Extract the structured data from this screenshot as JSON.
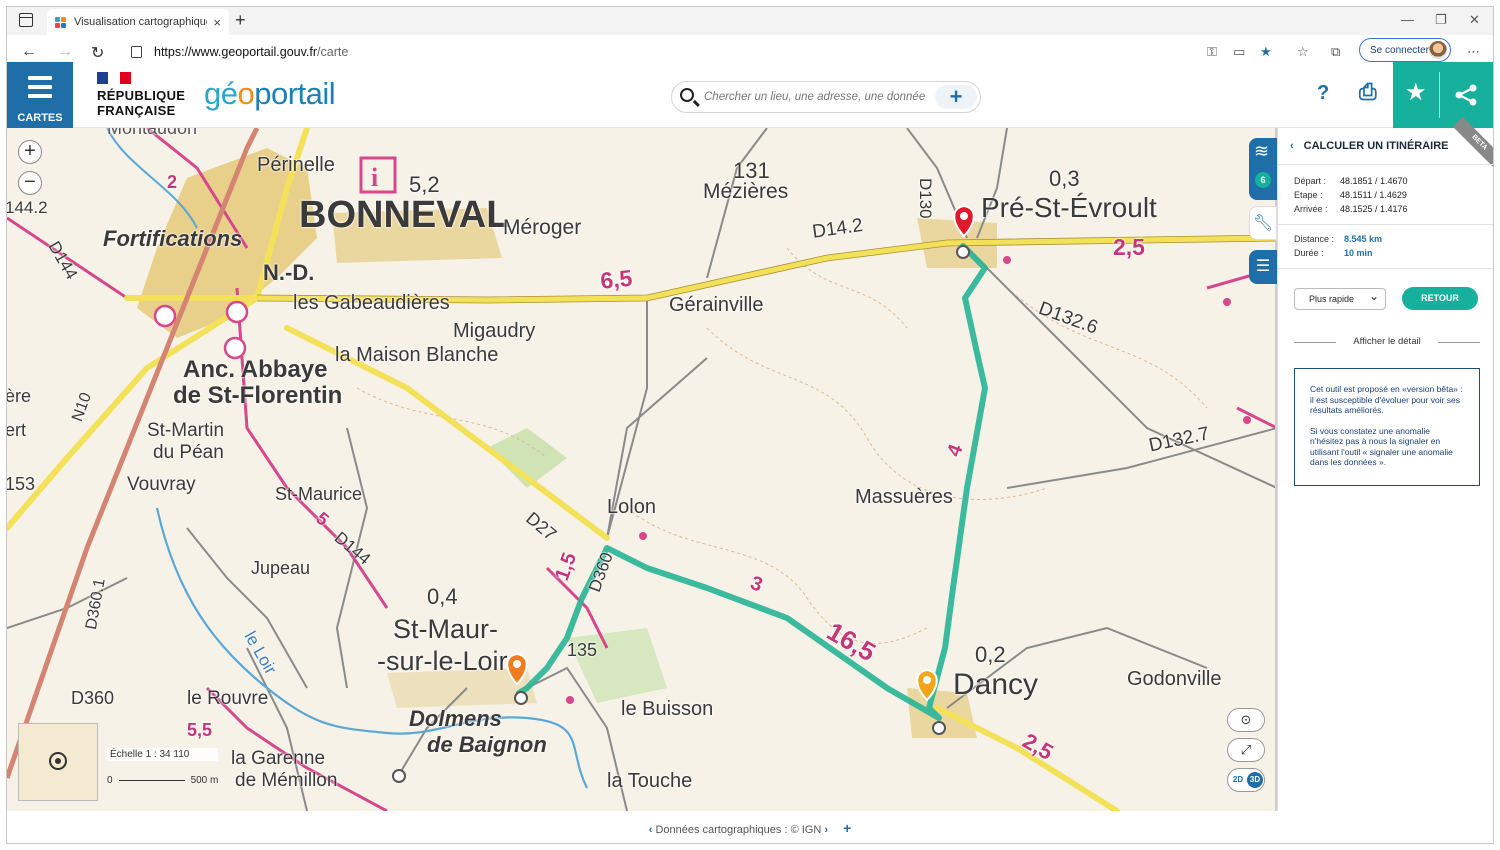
{
  "browser": {
    "tab_title": "Visualisation cartographique - G",
    "tab_close": "×",
    "new_tab": "+",
    "url_host": "https://www.geoportail.gouv.fr",
    "url_path": "/carte",
    "sign_in": "Se connecter",
    "win_min": "—",
    "win_max": "❐",
    "win_close": "✕",
    "back": "←",
    "forward": "→",
    "reload": "↻",
    "more": "⋯"
  },
  "header": {
    "menu_label": "CARTES",
    "rf_line1": "RÉPUBLIQUE",
    "rf_line2": "FRANÇAISE",
    "logo_part1": "gé",
    "logo_part2": "o",
    "logo_part3": "portail",
    "search_placeholder": "Chercher un lieu, une adresse, une donnée",
    "search_plus": "+",
    "help": "?",
    "print": "⎙",
    "star": "★",
    "share": "⋖"
  },
  "map": {
    "zoom_in": "+",
    "zoom_out": "−",
    "scale_label": "Échelle 1 : 34 110",
    "scale_zero": "0",
    "scale_dist": "500 m",
    "layers_count": "6",
    "btn_2d": "2D",
    "btn_3d": "3D",
    "locate": "⊙",
    "fullscreen": "⤢",
    "labels": [
      {
        "t": "Montaudon",
        "s": 18
      },
      {
        "t": "Périnelle",
        "s": 20
      },
      {
        "t": "BONNEVAL",
        "s": 38
      },
      {
        "t": "5,2",
        "s": 22
      },
      {
        "t": "131",
        "s": 22
      },
      {
        "t": "Mézières",
        "s": 21
      },
      {
        "t": "0,3",
        "s": 22
      },
      {
        "t": "Pré-St-Évroult",
        "s": 28
      },
      {
        "t": "D14.2",
        "s": 19
      },
      {
        "t": "Méroger",
        "s": 21
      },
      {
        "t": "Fortifications",
        "s": 22
      },
      {
        "t": "N.-D.",
        "s": 22
      },
      {
        "t": "les Gabeaudières",
        "s": 20
      },
      {
        "t": "6,5",
        "s": 23
      },
      {
        "t": "Gérainville",
        "s": 20
      },
      {
        "t": "2,5",
        "s": 23
      },
      {
        "t": "D132.6",
        "s": 19
      },
      {
        "t": "Migaudry",
        "s": 20
      },
      {
        "t": "la Maison Blanche",
        "s": 20
      },
      {
        "t": "Anc. Abbaye",
        "s": 24
      },
      {
        "t": "de St-Florentin",
        "s": 24
      },
      {
        "t": "D130",
        "s": 17
      },
      {
        "t": "St-Martin",
        "s": 19
      },
      {
        "t": "du Péan",
        "s": 19
      },
      {
        "t": "4",
        "s": 20
      },
      {
        "t": "D132.7",
        "s": 19
      },
      {
        "t": "Vouvray",
        "s": 19
      },
      {
        "t": "St-Maurice",
        "s": 18
      },
      {
        "t": "Lolon",
        "s": 20
      },
      {
        "t": "Massuères",
        "s": 20
      },
      {
        "t": "D27",
        "s": 18
      },
      {
        "t": "D144",
        "s": 17
      },
      {
        "t": "Jupeau",
        "s": 18
      },
      {
        "t": "0,4",
        "s": 22
      },
      {
        "t": "1,5",
        "s": 20
      },
      {
        "t": "D360",
        "s": 17
      },
      {
        "t": "3",
        "s": 20
      },
      {
        "t": "St-Maur-",
        "s": 27
      },
      {
        "t": "-sur-le-Loir",
        "s": 27
      },
      {
        "t": "135",
        "s": 18
      },
      {
        "t": "16,5",
        "s": 26
      },
      {
        "t": "0,2",
        "s": 22
      },
      {
        "t": "Dancy",
        "s": 30
      },
      {
        "t": "Godonville",
        "s": 20
      },
      {
        "t": "D360",
        "s": 18
      },
      {
        "t": "le Rouvre",
        "s": 19
      },
      {
        "t": "Dolmens",
        "s": 22
      },
      {
        "t": "de Baignon",
        "s": 22
      },
      {
        "t": "le Buisson",
        "s": 20
      },
      {
        "t": "la Garenne",
        "s": 19
      },
      {
        "t": "de Mémillon",
        "s": 19
      },
      {
        "t": "la Touche",
        "s": 20
      },
      {
        "t": "2,5",
        "s": 22
      },
      {
        "t": "D360.1",
        "s": 16
      },
      {
        "t": "N10",
        "s": 16
      },
      {
        "t": "le Loir",
        "s": 17
      },
      {
        "t": "144.2",
        "s": 17
      },
      {
        "t": "D144",
        "s": 17
      },
      {
        "t": "153",
        "s": 18
      },
      {
        "t": "ère",
        "s": 18
      },
      {
        "t": "ert",
        "s": 18
      },
      {
        "t": "5,5",
        "s": 18
      },
      {
        "t": "5",
        "s": 18
      },
      {
        "t": "2",
        "s": 18
      }
    ]
  },
  "panel": {
    "title": "CALCULER UN ITINÉRAIRE",
    "beta": "BETA",
    "depart_k": "Départ :",
    "depart_v": "48.1851 / 1.4670",
    "etape_k": "Etape :",
    "etape_v": "48.1511 / 1.4629",
    "arrivee_k": "Arrivée :",
    "arrivee_v": "48.1525 / 1.4176",
    "distance_k": "Distance :",
    "distance_v": "8.545 km",
    "duree_k": "Durée :",
    "duree_v": "10 min",
    "mode": "Plus rapide",
    "retour": "RETOUR",
    "detail": "Afficher le détail",
    "notice1": "Cet outil est proposé en «version bêta» : il est susceptible d'évoluer pour voir ses résultats améliorés.",
    "notice2": "Si vous constatez une anomalie n'hésitez pas à nous la signaler en utilisant l'outil « signaler une anomalie dans les données »."
  },
  "footer": {
    "prev": "‹",
    "text": "Données cartographiques : © IGN",
    "next": "›",
    "plus": "+"
  },
  "colors": {
    "brand_blue": "#1f6ea8",
    "teal": "#16b09c",
    "route": "#2bb596",
    "road_yellow": "#f4e15a",
    "road_pink": "#d6478c"
  }
}
